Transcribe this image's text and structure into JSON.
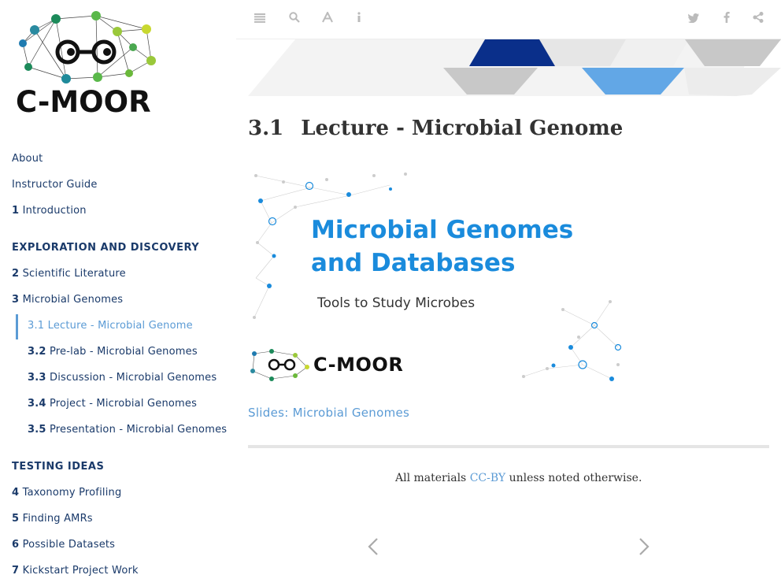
{
  "brand": {
    "name": "C-MOOR"
  },
  "toolbar": {
    "left_icons": [
      "menu-icon",
      "search-icon",
      "font-icon",
      "info-icon"
    ],
    "right_icons": [
      "twitter-icon",
      "facebook-icon",
      "share-icon"
    ]
  },
  "sidebar": {
    "top_items": [
      {
        "label": "About"
      },
      {
        "label": "Instructor Guide"
      },
      {
        "num": "1",
        "label": "Introduction"
      }
    ],
    "section1": {
      "heading": "EXPLORATION AND DISCOVERY"
    },
    "section1_items": [
      {
        "num": "2",
        "label": "Scientific Literature"
      },
      {
        "num": "3",
        "label": "Microbial Genomes"
      }
    ],
    "sub_items": [
      {
        "num": "3.1",
        "label": "Lecture - Microbial Genome"
      },
      {
        "num": "3.2",
        "label": "Pre-lab - Microbial Genomes"
      },
      {
        "num": "3.3",
        "label": "Discussion - Microbial Genomes"
      },
      {
        "num": "3.4",
        "label": "Project - Microbial Genomes"
      },
      {
        "num": "3.5",
        "label": "Presentation - Microbial Genomes"
      }
    ],
    "section2": {
      "heading": "TESTING IDEAS"
    },
    "section2_items": [
      {
        "num": "4",
        "label": "Taxonomy Profiling"
      },
      {
        "num": "5",
        "label": "Finding AMRs"
      },
      {
        "num": "6",
        "label": "Possible Datasets"
      },
      {
        "num": "7",
        "label": "Kickstart Project Work"
      }
    ]
  },
  "main": {
    "title_num": "3.1",
    "title": "Lecture - Microbial Genome",
    "slide": {
      "title_line1": "Microbial Genomes",
      "title_line2": "and Databases",
      "subtitle": "Tools to Study Microbes",
      "brand": "C-MOOR"
    },
    "slides_link": "Slides: Microbial Genomes",
    "footer": {
      "prefix": "All materials ",
      "link": "CC-BY",
      "suffix": " unless noted otherwise."
    }
  },
  "colors": {
    "accent": "#5b9bd5",
    "navy": "#1a3a6a",
    "slide_blue": "#1a8bdc"
  }
}
